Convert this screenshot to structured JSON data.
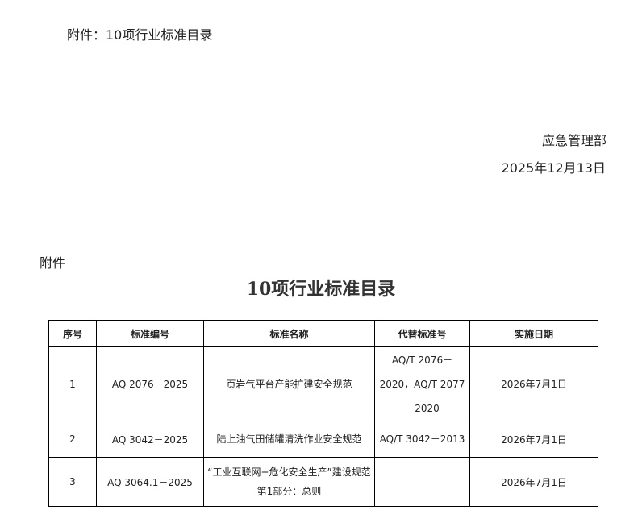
{
  "header": {
    "attachment_line": "附件：10项行业标准目录",
    "issuer": "应急管理部",
    "date": "2025年12月13日"
  },
  "appendix": {
    "label": "附件",
    "title": "10项行业标准目录"
  },
  "table": {
    "columns": [
      "序号",
      "标准编号",
      "标准名称",
      "代替标准号",
      "实施日期"
    ],
    "rows": [
      {
        "no": "1",
        "code": "AQ 2076－2025",
        "name": "页岩气平台产能扩建安全规范",
        "replaces": "AQ/T 2076－2020，AQ/T 2077－2020",
        "effective": "2026年7月1日"
      },
      {
        "no": "2",
        "code": "AQ 3042－2025",
        "name": "陆上油气田储罐清洗作业安全规范",
        "replaces": "AQ/T 3042－2013",
        "effective": "2026年7月1日"
      },
      {
        "no": "3",
        "code": "AQ 3064.1－2025",
        "name": "“工业互联网+危化安全生产”建设规范 第1部分：总则",
        "replaces": "",
        "effective": "2026年7月1日"
      }
    ]
  }
}
